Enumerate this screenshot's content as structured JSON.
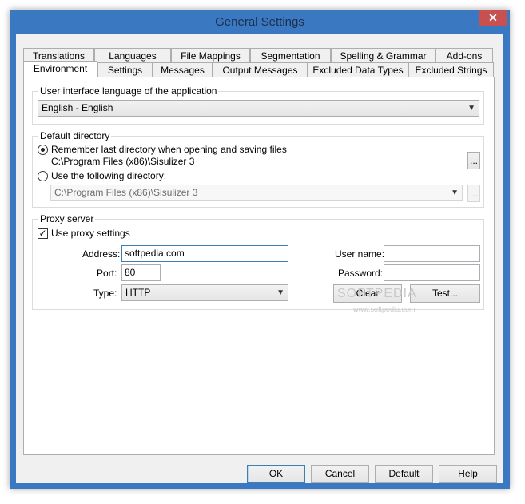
{
  "window": {
    "title": "General Settings",
    "close_label": "✕"
  },
  "tabs_row1": [
    "Translations",
    "Languages",
    "File Mappings",
    "Segmentation",
    "Spelling & Grammar",
    "Add-ons"
  ],
  "tabs_row2": [
    "Environment",
    "Settings",
    "Messages",
    "Output Messages",
    "Excluded Data Types",
    "Excluded Strings"
  ],
  "active_tab": "Environment",
  "ui_language": {
    "title": "User interface language of the application",
    "value": "English - English"
  },
  "default_directory": {
    "title": "Default directory",
    "option_remember": "Remember last directory when opening and saving files",
    "remember_path": "C:\\Program Files (x86)\\Sisulizer 3",
    "option_following": "Use the following directory:",
    "following_path": "C:\\Program Files (x86)\\Sisulizer 3",
    "browse_label": "...",
    "browse2_label": "...",
    "selected": "remember"
  },
  "proxy": {
    "title": "Proxy server",
    "use_label": "Use proxy settings",
    "use_checked": true,
    "address_label": "Address:",
    "address_value": "softpedia.com",
    "port_label": "Port:",
    "port_value": "80",
    "type_label": "Type:",
    "type_value": "HTTP",
    "username_label": "User name:",
    "username_value": "",
    "password_label": "Password:",
    "password_value": "",
    "clear_label": "Clear",
    "test_label": "Test..."
  },
  "watermark": {
    "big": "SOFTPEDIA",
    "url": "www.softpedia.com"
  },
  "buttons": {
    "ok": "OK",
    "cancel": "Cancel",
    "default": "Default",
    "help": "Help"
  }
}
